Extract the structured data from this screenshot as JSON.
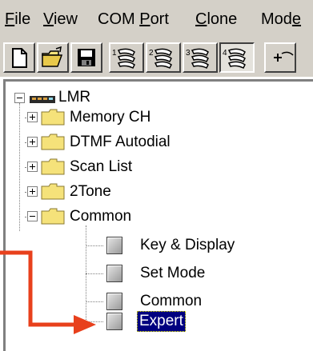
{
  "menu": {
    "file": {
      "first": "F",
      "rest": "ile"
    },
    "view": {
      "first": "V",
      "rest": "iew"
    },
    "comport": {
      "pre": "COM ",
      "first": "P",
      "rest": "ort"
    },
    "clone": {
      "first": "C",
      "rest": "lone"
    },
    "mode": {
      "pre": "Mod",
      "first": "e",
      "rest": ""
    }
  },
  "toolbar": {
    "buttons": [
      "new-icon",
      "open-icon",
      "save-icon",
      "radio-1-icon",
      "radio-2-icon",
      "radio-3-icon",
      "radio-4-icon",
      "plus-icon"
    ],
    "digits": [
      "1",
      "2",
      "3",
      "4"
    ],
    "pressed_index": 3
  },
  "tree": {
    "root": "LMR",
    "folders": [
      {
        "label": "Memory CH",
        "expanded": false
      },
      {
        "label": "DTMF Autodial",
        "expanded": false
      },
      {
        "label": "Scan List",
        "expanded": false
      },
      {
        "label": "2Tone",
        "expanded": false
      },
      {
        "label": "Common",
        "expanded": true
      }
    ],
    "common_children": [
      {
        "label": "Key & Display",
        "selected": false
      },
      {
        "label": "Set Mode",
        "selected": false
      },
      {
        "label": "Common",
        "selected": false
      },
      {
        "label": "Expert",
        "selected": true
      }
    ]
  },
  "colors": {
    "annotation_arrow": "#e8401c",
    "selection": "#000080",
    "folder": "#f5e27a",
    "chrome": "#d4d0c8"
  }
}
